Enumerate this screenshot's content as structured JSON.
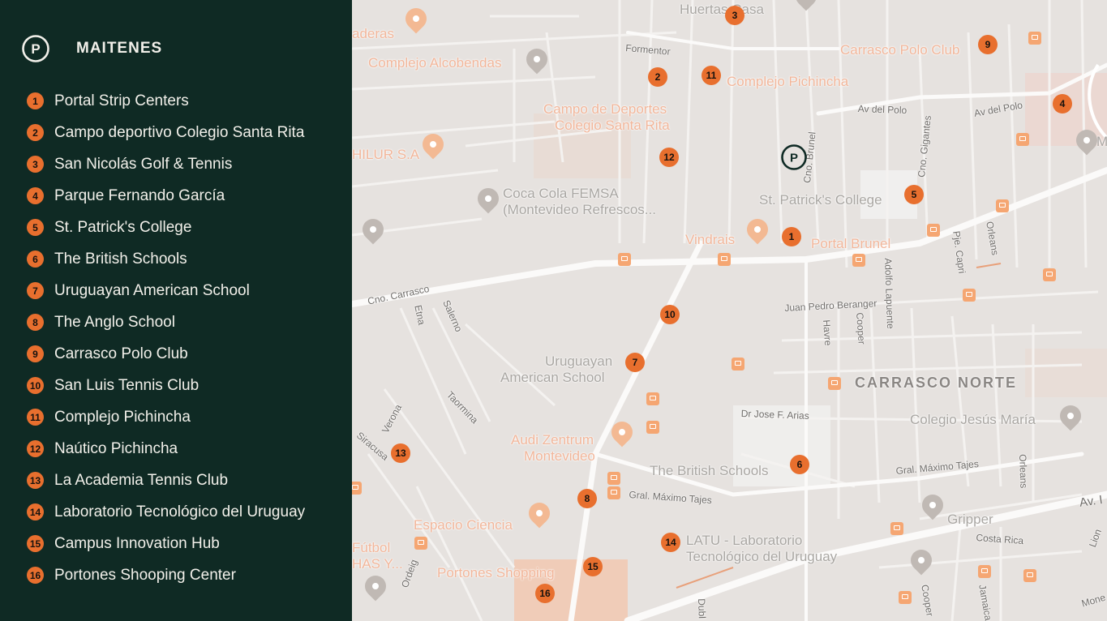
{
  "brand": {
    "title": "MAITENES",
    "logo_letter": "P"
  },
  "colors": {
    "sidebar_bg": "#0f2a24",
    "accent": "#e86f2e",
    "map_bg": "#e6e2df"
  },
  "legend": [
    {
      "num": "1",
      "label": "Portal Strip Centers"
    },
    {
      "num": "2",
      "label": "Campo deportivo Colegio Santa Rita"
    },
    {
      "num": "3",
      "label": "San Nicolás Golf & Tennis"
    },
    {
      "num": "4",
      "label": "Parque Fernando García"
    },
    {
      "num": "5",
      "label": "St. Patrick's College"
    },
    {
      "num": "6",
      "label": "The British Schools"
    },
    {
      "num": "7",
      "label": "Uruguayan American School"
    },
    {
      "num": "8",
      "label": "The Anglo School"
    },
    {
      "num": "9",
      "label": "Carrasco Polo Club"
    },
    {
      "num": "10",
      "label": "San Luis Tennis Club"
    },
    {
      "num": "11",
      "label": "Complejo Pichincha"
    },
    {
      "num": "12",
      "label": "Naútico Pichincha"
    },
    {
      "num": "13",
      "label": "La Academia Tennis Club"
    },
    {
      "num": "14",
      "label": "Laboratorio Tecnológico del Uruguay"
    },
    {
      "num": "15",
      "label": "Campus Innovation Hub"
    },
    {
      "num": "16",
      "label": "Portones Shooping Center"
    }
  ],
  "map": {
    "places": {
      "huertas": "Huertas Casa",
      "aderas": "aderas",
      "alcobendas": "Complejo Alcobendas",
      "polo": "Carrasco Polo Club",
      "pichincha": "Complejo Pichincha",
      "santarita1": "Campo de Deportes",
      "santarita2": "Colegio Santa Rita",
      "hilur": "HILUR S.A",
      "cocacola1": "Coca Cola FEMSA",
      "cocacola2": "(Montevideo Refrescos...",
      "stpatrick": "St. Patrick's College",
      "vindrais": "Vindrais",
      "portal": "Portal Brunel",
      "uas1": "Uruguayan",
      "uas2": "American School",
      "carrasconorte": "CARRASCO NORTE",
      "jesusmaria": "Colegio Jesús María",
      "audi1": "Audi Zentrum",
      "audi2": "Montevideo",
      "british": "The British Schools",
      "espacio": "Espacio Ciencia",
      "gripper": "Gripper",
      "futbol1": "Fútbol",
      "futbol2": "HAS Y...",
      "latu1": "LATU - Laboratorio",
      "latu2": "Tecnológico del Uruguay",
      "portones": "Portones Shopping",
      "m": "M"
    },
    "streets": {
      "formentor": "Formentor",
      "avpolo1": "Av del Polo",
      "avpolo2": "Av del Polo",
      "cnobrunel": "Cno. Brunel",
      "cnogigantes": "Cno. Gigantes",
      "orleans1": "Orleans",
      "pjecapri": "Pje. Capri",
      "adolfo": "Adolfo Lapuente",
      "cooper1": "Cooper",
      "havre": "Havre",
      "berenger": "Juan Pedro Beranger",
      "cnocarrasco": "Cno. Carrasco",
      "etna": "Etna",
      "salerno": "Salerno",
      "taormina": "Taormina",
      "arias": "Dr Jose F. Arias",
      "tajes1": "Gral. Máximo Tajes",
      "tajes2": "Gral. Máximo Tajes",
      "orleans2": "Orleans",
      "verona": "Verona",
      "siracusa": "Siracusa",
      "costarica": "Costa Rica",
      "av": "Av. I",
      "ordeig": "Ordeig",
      "dub": "Dubl",
      "cooper2": "Cooper",
      "jamaica": "Jamaica",
      "lion": "Lion",
      "mone": "Mone"
    }
  }
}
